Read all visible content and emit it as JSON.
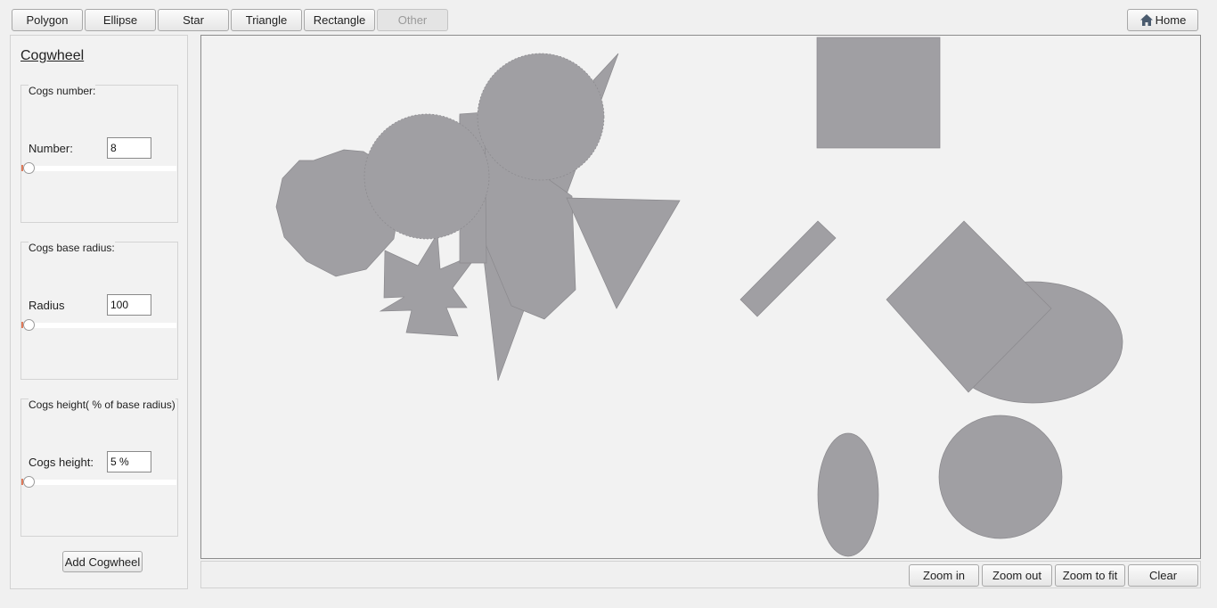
{
  "toolbar": {
    "tabs": [
      {
        "label": "Polygon",
        "enabled": true
      },
      {
        "label": "Ellipse",
        "enabled": true
      },
      {
        "label": "Star",
        "enabled": true
      },
      {
        "label": "Triangle",
        "enabled": true
      },
      {
        "label": "Rectangle",
        "enabled": true
      },
      {
        "label": "Other",
        "enabled": false
      }
    ],
    "home_label": "Home",
    "home_icon": "home-icon"
  },
  "sidebar": {
    "title": "Cogwheel",
    "groups": [
      {
        "title": "Cogs number:",
        "field_label": "Number:",
        "value": "8",
        "slider_fraction": 0
      },
      {
        "title": "Cogs base radius:",
        "field_label": "Radius",
        "value": "100",
        "slider_fraction": 0
      },
      {
        "title": "Cogs height( % of base radius)",
        "field_label": "Cogs height:",
        "value": "5 %",
        "slider_fraction": 0
      }
    ],
    "add_button": "Add Cogwheel"
  },
  "canvas": {
    "shape_fill": "#a09fa3",
    "shape_stroke": "#8a898d"
  },
  "bottom": {
    "zoom_in": "Zoom in",
    "zoom_out": "Zoom out",
    "zoom_fit": "Zoom to fit",
    "clear": "Clear"
  }
}
